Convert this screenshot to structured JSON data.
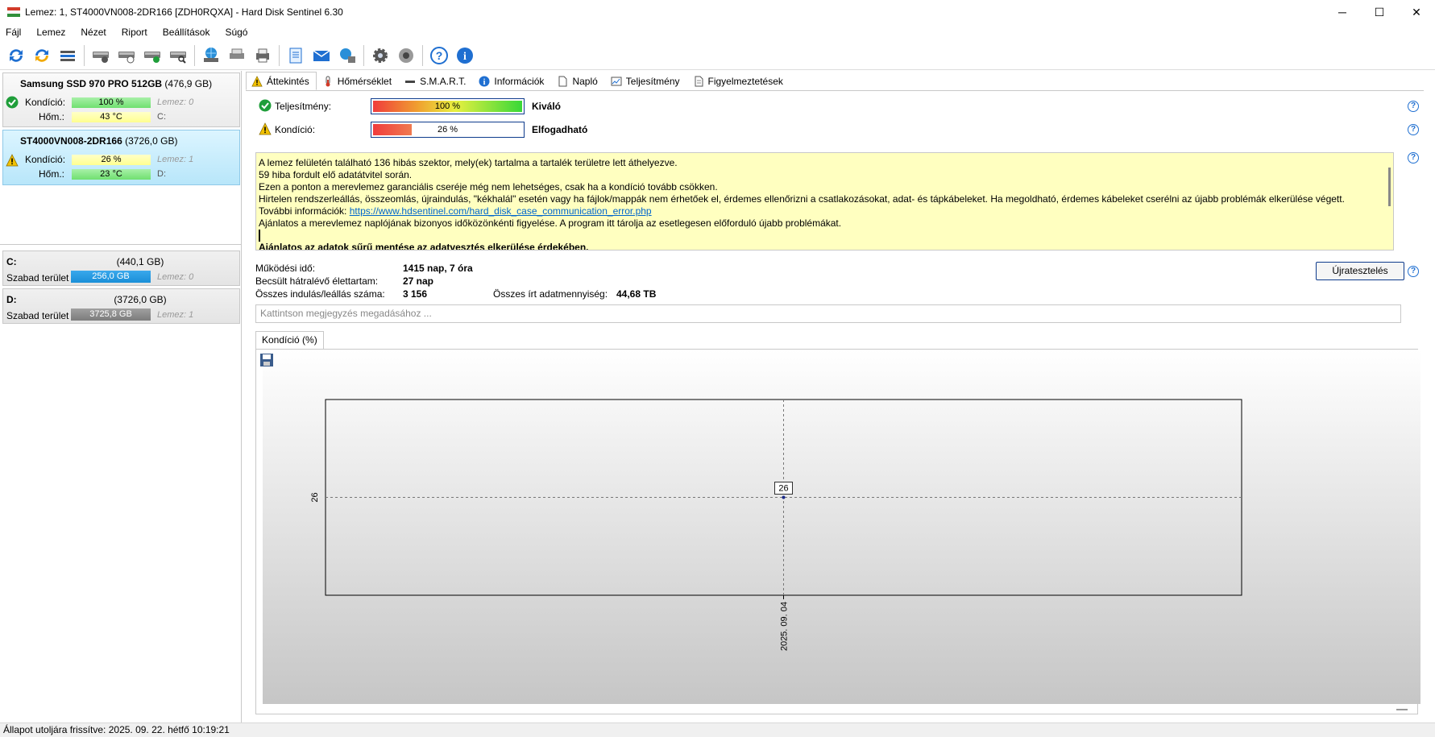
{
  "window": {
    "title": "Lemez: 1, ST4000VN008-2DR166 [ZDH0RQXA]  -  Hard Disk Sentinel 6.30",
    "minimize": "─",
    "maximize": "☐",
    "close": "✕"
  },
  "menu": [
    "Fájl",
    "Lemez",
    "Nézet",
    "Riport",
    "Beállítások",
    "Súgó"
  ],
  "disks": [
    {
      "name": "Samsung SSD 970 PRO 512GB",
      "size": "(476,9 GB)",
      "condition_label": "Kondíció:",
      "condition": "100 %",
      "condition_value": 100,
      "temp_label": "Hőm.:",
      "temp": "43 °C",
      "disk_index": "Lemez: 0",
      "drive": "C:",
      "status": "ok"
    },
    {
      "name": "ST4000VN008-2DR166",
      "size": "(3726,0 GB)",
      "condition_label": "Kondíció:",
      "condition": "26 %",
      "condition_value": 26,
      "temp_label": "Hőm.:",
      "temp": "23 °C",
      "disk_index": "Lemez: 1",
      "drive": "D:",
      "status": "warning"
    }
  ],
  "volumes": [
    {
      "name": "C:",
      "size": "(440,1 GB)",
      "free_label": "Szabad terület",
      "free": "256,0 GB",
      "disk": "Lemez: 0",
      "color": "#1a8fd8"
    },
    {
      "name": "D:",
      "size": "(3726,0 GB)",
      "free_label": "Szabad terület",
      "free": "3725,8 GB",
      "disk": "Lemez: 1",
      "color": "#8c8c8c"
    }
  ],
  "tabs": [
    "Áttekintés",
    "Hőmérséklet",
    "S.M.A.R.T.",
    "Információk",
    "Napló",
    "Teljesítmény",
    "Figyelmeztetések"
  ],
  "overview": {
    "performance_label": "Teljesítmény:",
    "performance": "100 %",
    "performance_value": 100,
    "performance_rating": "Kiváló",
    "condition_label": "Kondíció:",
    "condition": "26 %",
    "condition_value": 26,
    "condition_rating": "Elfogadható",
    "messages": [
      "A lemez felületén található 136 hibás szektor, mely(ek) tartalma a tartalék területre lett áthelyezve.",
      "59 hiba fordult elő adatátvitel során.",
      "Ezen a ponton a merevlemez garanciális cseréje még nem lehetséges, csak ha a kondíció tovább csökken.",
      "Hirtelen rendszerleállás, összeomlás, újraindulás, \"kékhalál\" esetén vagy ha fájlok/mappák nem érhetőek el, érdemes ellenőrizni a csatlakozásokat, adat- és tápkábeleket. Ha megoldható, érdemes kábeleket cserélni az újabb problémák elkerülése végett.",
      "Ajánlatos a merevlemez naplójának bizonyos időközönkénti figyelése. A program itt tárolja az esetlegesen előforduló újabb problémákat."
    ],
    "more_info_label": "További információk:",
    "more_info_link": "https://www.hdsentinel.com/hard_disk_case_communication_error.php",
    "advice": "Ajánlatos az adatok sűrű mentése az adatvesztés elkerülése érdekében.",
    "uptime_label": "Működési idő:",
    "uptime": "1415 nap, 7 óra",
    "lifetime_label": "Becsült hátralévő élettartam:",
    "lifetime": "27 nap",
    "starts_label": "Összes indulás/leállás száma:",
    "starts": "3 156",
    "written_label": "Összes írt adatmennyiség:",
    "written": "44,68 TB",
    "retest": "Újratesztelés",
    "note_placeholder": "Kattintson megjegyzés megadásához ...",
    "chart_tab": "Kondíció  (%)"
  },
  "chart_data": {
    "type": "line",
    "title": "",
    "xlabel": "",
    "ylabel": "",
    "x": [
      "2025. 09. 04"
    ],
    "series": [
      {
        "values": [
          26
        ]
      }
    ],
    "ylim": [
      26,
      26
    ],
    "y_ticks": [
      "26"
    ],
    "data_labels": [
      "26"
    ],
    "grid": true
  },
  "statusbar": "Állapot utoljára frissítve: 2025. 09. 22. hétfő 10:19:21",
  "colors": {
    "ok": "#1f9e3a",
    "warning": "#f2c200",
    "link": "#0066cc",
    "message_bg": "#ffffc0",
    "bar_green": "#7fe27f",
    "bar_yellow": "#ffff99"
  }
}
